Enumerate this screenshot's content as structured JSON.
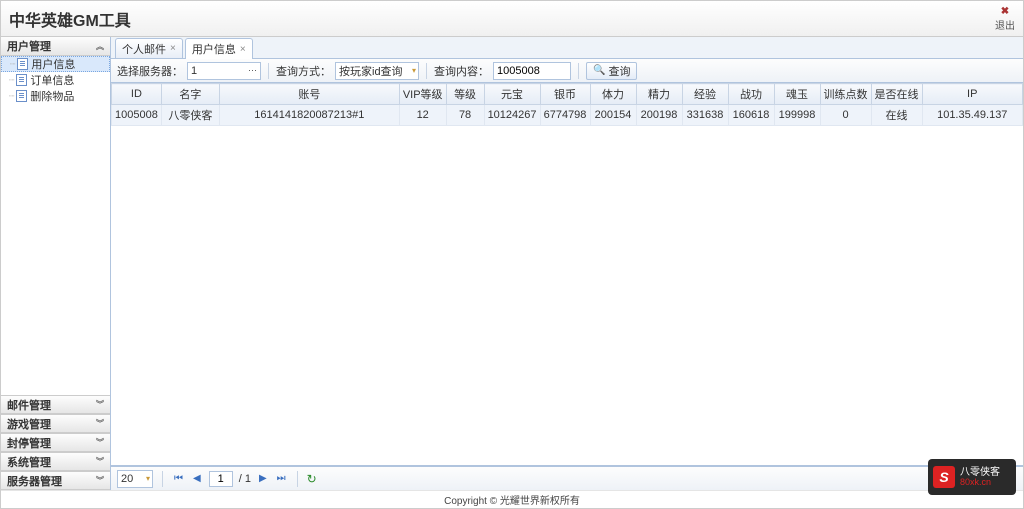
{
  "app": {
    "title": "中华英雄GM工具",
    "exit": "退出"
  },
  "sidebar": {
    "panels": [
      {
        "label": "用户管理",
        "open": true
      },
      {
        "label": "邮件管理",
        "open": false
      },
      {
        "label": "游戏管理",
        "open": false
      },
      {
        "label": "封停管理",
        "open": false
      },
      {
        "label": "系统管理",
        "open": false
      },
      {
        "label": "服务器管理",
        "open": false
      }
    ],
    "items": [
      {
        "label": "用户信息",
        "selected": true
      },
      {
        "label": "订单信息",
        "selected": false
      },
      {
        "label": "删除物品",
        "selected": false
      }
    ]
  },
  "tabs": [
    {
      "label": "个人邮件",
      "active": false
    },
    {
      "label": "用户信息",
      "active": true
    }
  ],
  "toolbar": {
    "server_label": "选择服务器：",
    "server_value": "1",
    "method_label": "查询方式：",
    "method_value": "按玩家id查询",
    "query_label": "查询内容：",
    "query_value": "1005008",
    "search_btn": "查询"
  },
  "grid": {
    "headers": [
      "ID",
      "名字",
      "账号",
      "VIP等级",
      "等级",
      "元宝",
      "银币",
      "体力",
      "精力",
      "经验",
      "战功",
      "魂玉",
      "训练点数",
      "是否在线",
      "IP"
    ],
    "rows": [
      [
        "1005008",
        "八零侠客",
        "1614141820087213#1",
        "12",
        "78",
        "10124267",
        "6774798",
        "200154",
        "200198",
        "331638",
        "160618",
        "199998",
        "0",
        "在线",
        "101.35.49.137"
      ]
    ]
  },
  "pager": {
    "page_size": "20",
    "page": "1",
    "total": "/ 1"
  },
  "footer": {
    "copyright": "Copyright © 光耀世界新权所有"
  },
  "watermark": {
    "logo": "S",
    "line1": "八零侠客",
    "line2": "80xk.cn"
  }
}
